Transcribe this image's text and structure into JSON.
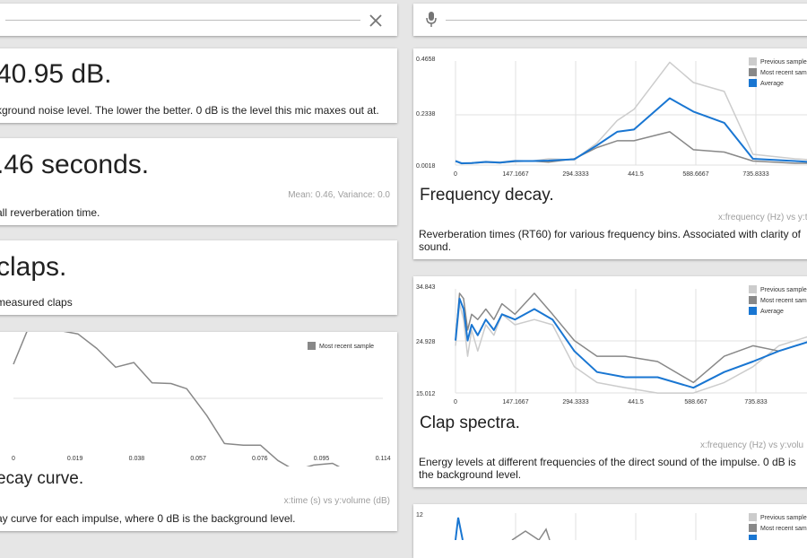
{
  "left": {
    "noise": {
      "value": "40.95 dB.",
      "description": "kground noise level. The lower the better. 0 dB is the level this mic maxes out at."
    },
    "reverb": {
      "value": ".46 seconds.",
      "stats": "Mean: 0.46, Variance: 0.0",
      "description": "all reverberation time."
    },
    "claps": {
      "value": " claps.",
      "description": "measured claps"
    },
    "decay": {
      "title": "ecay curve.",
      "axes": "x:time (s) vs y:volume (dB)",
      "description": "ay curve for each impulse, where 0 dB is the background level."
    }
  },
  "right": {
    "frequency": {
      "title": "Frequency decay.",
      "axes": "x:frequency (Hz) vs y:tim",
      "description": "Reverberation times (RT60) for various frequency bins. Associated with clarity of sound."
    },
    "spectra": {
      "title": "Clap spectra.",
      "axes": "x:frequency (Hz) vs y:volu",
      "description": "Energy levels at different frequencies of the direct sound of the impulse. 0 dB is the background level."
    }
  },
  "icons": {
    "close": "close-icon",
    "mic": "mic-icon"
  },
  "colors": {
    "average": "#1976d2",
    "recent": "#888888",
    "previous": "#cccccc",
    "grid": "#e0e0e0"
  },
  "chart_data": [
    {
      "type": "line",
      "id": "decay",
      "xticks": [
        "0",
        "0.019",
        "0.038",
        "0.057",
        "0.076",
        "0.095",
        "0.114"
      ],
      "xrange": [
        0,
        0.1175
      ],
      "yrange": [
        -1,
        1
      ],
      "legend": [
        "Most recent sample"
      ],
      "series": [
        {
          "name": "Most recent sample",
          "x": [
            0,
            0.0055,
            0.0105,
            0.0155,
            0.0205,
            0.0265,
            0.0325,
            0.0383,
            0.0441,
            0.0501,
            0.0551,
            0.0615,
            0.0671,
            0.0731,
            0.0786,
            0.0841,
            0.0895,
            0.0955,
            0.1015,
            0.1075,
            0.1175
          ],
          "y": [
            0.6,
            1.32,
            1.35,
            1.17,
            1.12,
            0.87,
            0.55,
            0.63,
            0.28,
            0.27,
            0.18,
            -0.28,
            -0.76,
            -0.79,
            -0.79,
            -1.05,
            -1.22,
            -1.13,
            -1.1,
            -1.27,
            -1.5
          ]
        }
      ]
    },
    {
      "type": "line",
      "id": "frequency",
      "xticks": [
        "0",
        "147.1667",
        "294.3333",
        "441.5",
        "588.6667",
        "735.8333"
      ],
      "yticks": [
        "0.0018",
        "0.2338",
        "0.4658"
      ],
      "xrange": [
        0,
        883
      ],
      "yrange": [
        0.0018,
        0.4658
      ],
      "legend": [
        "Previous samples",
        "Most recent sample",
        "Average"
      ],
      "series": [
        {
          "name": "Previous samples",
          "x": [
            0,
            15,
            40,
            75,
            110,
            147,
            190,
            230,
            294,
            350,
            400,
            441.5,
            530,
            588.7,
            665,
            735.8,
            840,
            883
          ],
          "y": [
            0.02,
            0.01,
            0.012,
            0.018,
            0.015,
            0.022,
            0.02,
            0.03,
            0.025,
            0.1,
            0.2,
            0.25,
            0.46,
            0.37,
            0.33,
            0.05,
            0.03,
            0.025
          ]
        },
        {
          "name": "Most recent sample",
          "x": [
            0,
            15,
            40,
            75,
            110,
            147,
            190,
            230,
            294,
            350,
            400,
            441.5,
            530,
            588.7,
            665,
            735.8,
            840,
            883
          ],
          "y": [
            0.02,
            0.008,
            0.01,
            0.015,
            0.012,
            0.018,
            0.02,
            0.015,
            0.03,
            0.08,
            0.11,
            0.11,
            0.15,
            0.07,
            0.06,
            0.02,
            0.01,
            0.01
          ]
        },
        {
          "name": "Average",
          "x": [
            0,
            15,
            40,
            75,
            110,
            147,
            190,
            230,
            294,
            350,
            400,
            441.5,
            530,
            588.7,
            665,
            735.8,
            840,
            883
          ],
          "y": [
            0.02,
            0.01,
            0.011,
            0.016,
            0.013,
            0.02,
            0.02,
            0.022,
            0.028,
            0.09,
            0.15,
            0.16,
            0.3,
            0.24,
            0.19,
            0.03,
            0.02,
            0.015
          ]
        }
      ]
    },
    {
      "type": "line",
      "id": "spectra",
      "xticks": [
        "0",
        "147.1667",
        "294.3333",
        "441.5",
        "588.667",
        "735.833"
      ],
      "yticks": [
        "15.012",
        "24.928",
        "34.843"
      ],
      "xrange": [
        0,
        883
      ],
      "yrange": [
        15.012,
        34.843
      ],
      "legend": [
        "Previous samples",
        "Most recent sample",
        "Average"
      ],
      "series": [
        {
          "name": "Previous samples",
          "x": [
            0,
            10,
            20,
            30,
            40,
            55,
            75,
            95,
            115,
            147,
            195,
            240,
            294,
            350,
            420,
            500,
            588.7,
            665,
            735.8,
            800,
            883
          ],
          "y": [
            24,
            32,
            29,
            22,
            27,
            23,
            28,
            26,
            30,
            28,
            29,
            28,
            20,
            17,
            16,
            15,
            15,
            17,
            20,
            24,
            26
          ]
        },
        {
          "name": "Most recent sample",
          "x": [
            0,
            10,
            20,
            30,
            40,
            55,
            75,
            95,
            115,
            147,
            195,
            240,
            294,
            350,
            420,
            500,
            588.7,
            665,
            735.8,
            800,
            883
          ],
          "y": [
            25,
            34,
            33,
            27,
            30,
            29,
            31,
            29,
            32,
            30,
            34,
            30,
            25,
            22,
            22,
            21,
            17,
            22,
            24,
            23,
            25
          ]
        },
        {
          "name": "Average",
          "x": [
            0,
            10,
            20,
            30,
            40,
            55,
            75,
            95,
            115,
            147,
            195,
            240,
            294,
            350,
            420,
            500,
            588.7,
            665,
            735.8,
            800,
            883
          ],
          "y": [
            25,
            33,
            31,
            25,
            28,
            26,
            29,
            27,
            30,
            29,
            31,
            29,
            23,
            19,
            18,
            18,
            16,
            19,
            21,
            23,
            25
          ]
        }
      ]
    },
    {
      "type": "line",
      "id": "bottom",
      "yticks": [
        "12"
      ],
      "legend": [
        "Previous samples",
        "Most recent sample"
      ],
      "series": []
    }
  ]
}
